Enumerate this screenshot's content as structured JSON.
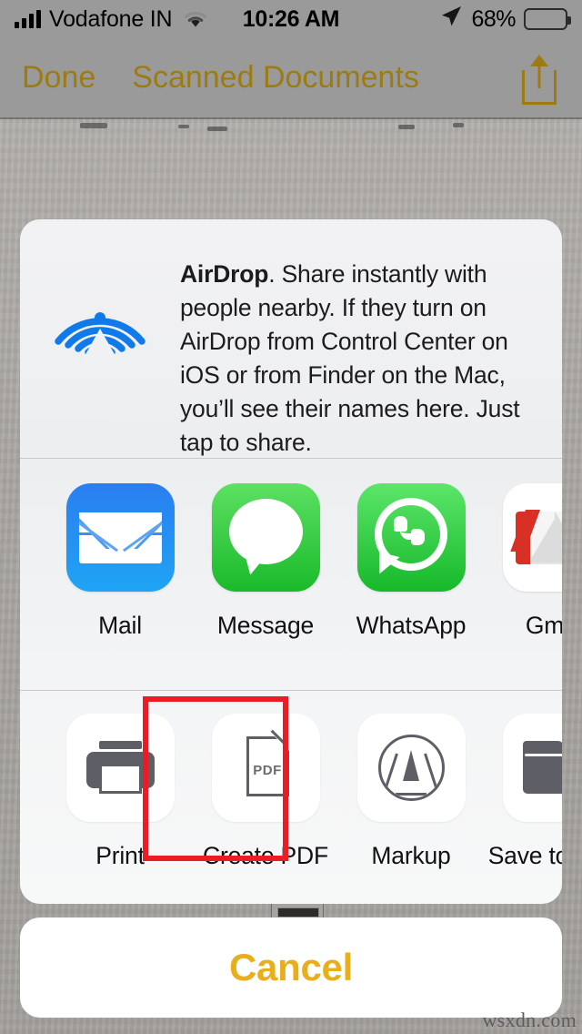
{
  "status_bar": {
    "carrier": "Vodafone IN",
    "time": "10:26 AM",
    "battery_percent": "68%",
    "battery_level": 68,
    "signal_bars": 4,
    "wifi_icon": "wifi-icon",
    "location_icon": "location-arrow-icon"
  },
  "nav_bar": {
    "done_label": "Done",
    "title": "Scanned Documents",
    "share_icon": "share-icon",
    "tint_color": "#9d7b13"
  },
  "share_sheet": {
    "airdrop": {
      "icon": "airdrop-icon",
      "title": "AirDrop",
      "description": ". Share instantly with people nearby. If they turn on AirDrop from Control Center on iOS or from Finder on the Mac, you’ll see their names here. Just tap to share."
    },
    "apps": [
      {
        "label": "Mail",
        "icon": "mail-icon"
      },
      {
        "label": "Message",
        "icon": "messages-icon"
      },
      {
        "label": "WhatsApp",
        "icon": "whatsapp-icon"
      },
      {
        "label": "Gmail",
        "icon": "gmail-icon"
      }
    ],
    "actions": [
      {
        "label": "Print",
        "icon": "printer-icon",
        "highlighted": false
      },
      {
        "label": "Create PDF",
        "icon": "pdf-document-icon",
        "highlighted": true
      },
      {
        "label": "Markup",
        "icon": "markup-pen-icon",
        "highlighted": false
      },
      {
        "label": "Save to Files",
        "icon": "folder-icon",
        "highlighted": false
      }
    ],
    "pdf_icon_text": "PDF",
    "highlight_color": "#ec1c24"
  },
  "cancel": {
    "label": "Cancel",
    "color": "#e9ae1c"
  },
  "watermark": "wsxdn.com"
}
